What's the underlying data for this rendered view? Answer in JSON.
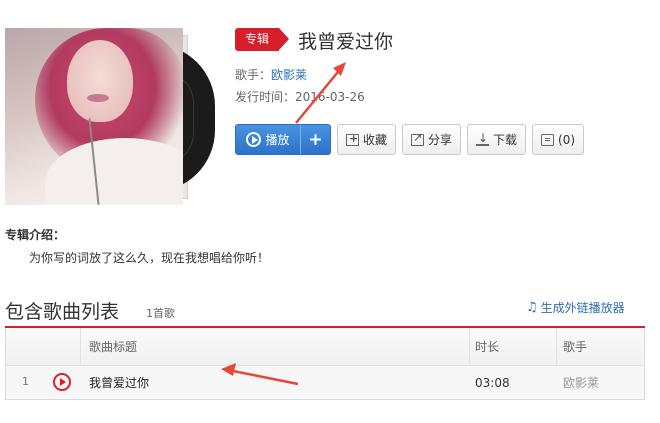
{
  "album": {
    "badge": "专辑",
    "title": "我曾爱过你",
    "artist_label": "歌手：",
    "artist_name": "欧影莱",
    "release_label": "发行时间：",
    "release_date": "2016-03-26"
  },
  "actions": {
    "play": "播放",
    "add": "+",
    "favorite": "收藏",
    "share": "分享",
    "download": "下载",
    "comment": "(0)"
  },
  "intro": {
    "label": "专辑介绍：",
    "text": "为你写的词放了这么久，现在我想唱给你听！"
  },
  "song_list": {
    "title": "包含歌曲列表",
    "count": "1首歌",
    "generate_link": "生成外链播放器",
    "columns": {
      "title": "歌曲标题",
      "duration": "时长",
      "artist": "歌手"
    },
    "rows": [
      {
        "index": "1",
        "title": "我曾爱过你",
        "duration": "03:08",
        "artist": "欧影莱"
      }
    ]
  },
  "colors": {
    "accent": "#d61f2b",
    "primary_button": "#2c72cb",
    "link": "#2c6fb5"
  }
}
